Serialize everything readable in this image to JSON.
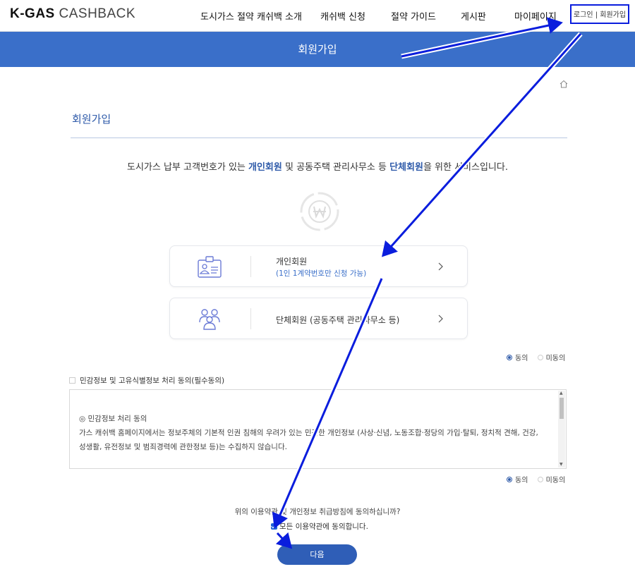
{
  "header": {
    "logo_bold": "K-GAS",
    "logo_light": "CASHBACK",
    "nav": [
      {
        "label": "도시가스 절약 캐쉬백 소개"
      },
      {
        "label": "캐쉬백 신청"
      },
      {
        "label": "절약 가이드"
      },
      {
        "label": "게시판"
      },
      {
        "label": "마이페이지"
      }
    ],
    "login_link": "로그인 | 회원가입"
  },
  "banner": {
    "title": "회원가입"
  },
  "section": {
    "title": "회원가입"
  },
  "intro": {
    "part1": "도시가스 납부 고객번호가 있는 ",
    "highlight1": "개인회원",
    "part2": " 및 공동주택 관리사무소 등 ",
    "highlight2": "단체회원",
    "part3": "을 위한 서비스입니다."
  },
  "cards": [
    {
      "title": "개인회원",
      "subtitle": "(1인 1계약번호만 신청 가능)"
    },
    {
      "title": "단체회원 (공동주택 관리사무소 등)"
    }
  ],
  "consent_top": {
    "agree": "동의",
    "disagree": "미동의"
  },
  "privacy": {
    "checkbox_label": "민감정보 및 고유식별정보 처리 동의(필수동의)",
    "lines": [
      "◎ 민감정보 처리 동의",
      "가스 캐쉬백 홈페이지에서는 정보주체의 기본적 인권 침해의 우려가 있는 민감한 개인정보 (사상·신념, 노동조합·정당의 가입·탈퇴, 정치적 견해, 건강,",
      "성생활, 유전정보 및 범죄경력에 관한정보 등)는 수집하지 않습니다."
    ]
  },
  "consent_bottom": {
    "agree": "동의",
    "disagree": "미동의"
  },
  "footer": {
    "question": "위의 이용약관 및 개인정보 취급방침에 동의하십니까?",
    "agree_all": "모든 이용약관에 동의합니다.",
    "next_button": "다음"
  },
  "colors": {
    "brand_blue": "#3a6fc9",
    "button_blue": "#2f5eb7",
    "annotation_blue": "#0a1ddd"
  }
}
